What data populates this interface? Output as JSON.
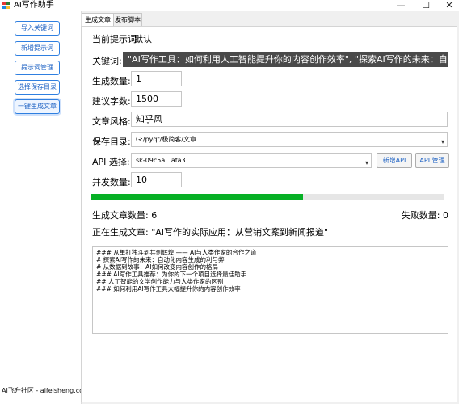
{
  "window": {
    "title": "AI写作助手",
    "controls": {
      "minimize": "—",
      "maximize": "☐",
      "close": "✕"
    },
    "logo_colors": [
      "#e53935",
      "#2e7d32",
      "#1e88e5",
      "#fbc02d"
    ]
  },
  "sidebar": {
    "items": [
      {
        "label": "导入关键词"
      },
      {
        "label": "新增提示词"
      },
      {
        "label": "提示词管理"
      },
      {
        "label": "选择保存目录"
      },
      {
        "label": "一键生成文章"
      }
    ],
    "footer": "AI飞升社区 - aifeisheng.com"
  },
  "tabs": [
    {
      "label": "生成文章",
      "active": true
    },
    {
      "label": "发布脚本",
      "active": false
    }
  ],
  "form": {
    "current_prompt_label": "当前提示词:",
    "current_prompt_value": "默认",
    "keywords_label": "关键词:",
    "keywords_value": "\"AI写作工具：如何利用人工智能提升你的内容创作效率\", \"探索AI写作的未来：自动化内容生成",
    "count_label": "生成数量:",
    "count_value": "1",
    "words_label": "建议字数:",
    "words_value": "1500",
    "style_label": "文章风格:",
    "style_value": "知乎风",
    "dir_label": "保存目录:",
    "dir_value": "G:/pyqt/极简客/文章",
    "api_label": "API 选择:",
    "api_value": "sk-09c5a...afa3",
    "new_api_label": "新增API",
    "api_manage_label": "API 管理",
    "concurrency_label": "并发数量:",
    "concurrency_value": "10"
  },
  "progress": {
    "value": 0.6,
    "color": "#06b025"
  },
  "stats": {
    "generated": "生成文章数量: 6",
    "failed": "失败数量: 0"
  },
  "current_status": "正在生成文章: \"AI写作的实际应用：从营销文案到新闻报道\"",
  "log": [
    "### 从单打独斗到共创辉煌 —— AI与人类作家的合作之道",
    "# 探索AI写作的未来：自动化内容生成的利与弊",
    "# 从数据到故事：AI如何改变内容创作的格局",
    "### AI写作工具推荐：为你的下一个项目选择最佳助手",
    "## 人工智能的文学创作能力与人类作家的区别",
    "### 如何利用AI写作工具大幅提升你的内容创作效率"
  ]
}
